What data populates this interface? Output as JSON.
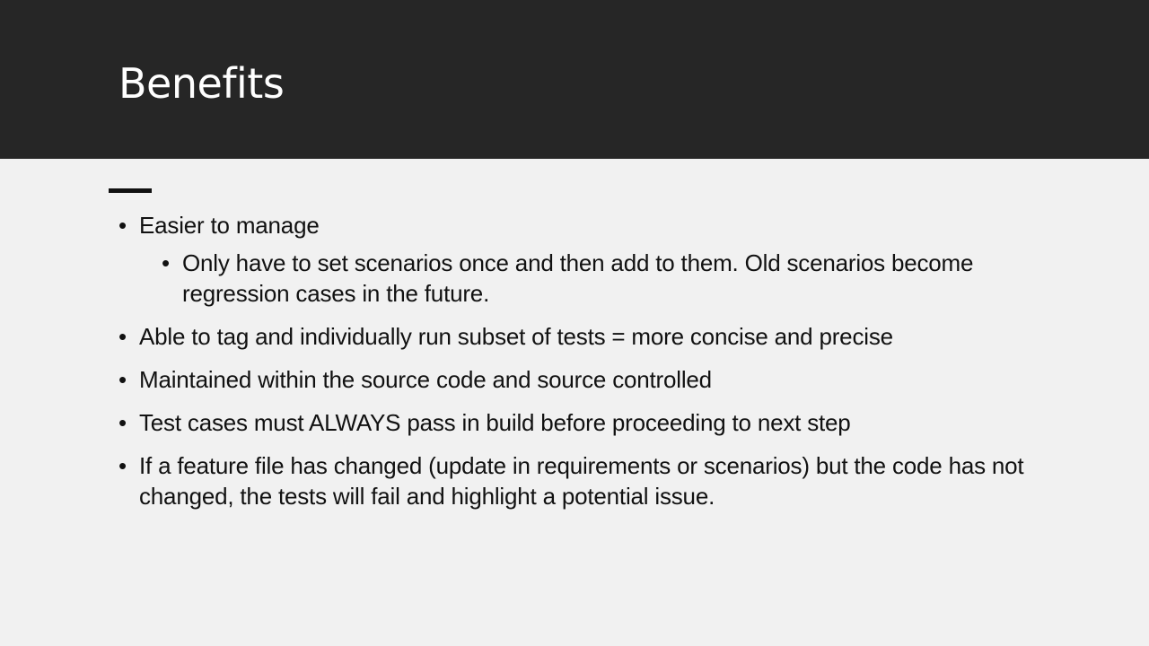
{
  "slide": {
    "title": "Benefits",
    "bullets": [
      {
        "text": "Easier to manage",
        "sub": [
          "Only have to set scenarios once and then add to them. Old scenarios become regression cases in the future."
        ]
      },
      {
        "text": "Able to tag and individually run subset of tests = more concise and precise"
      },
      {
        "text": "Maintained within the source code and source controlled"
      },
      {
        "text": "Test cases must ALWAYS pass in build before proceeding to next step"
      },
      {
        "text": "If a feature file has changed (update in requirements or scenarios) but the code has not changed, the tests will fail and highlight a potential issue."
      }
    ],
    "bullet_glyph": "•"
  },
  "colors": {
    "title_band": "#262626",
    "title_text": "#ffffff",
    "background": "#f1f1f1",
    "body_text": "#111111"
  }
}
